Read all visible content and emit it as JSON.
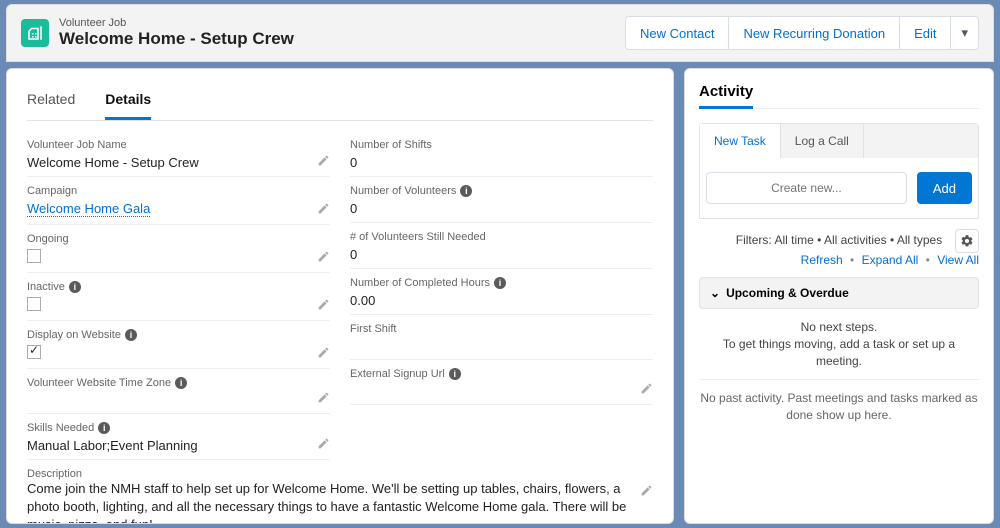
{
  "header": {
    "record_type": "Volunteer Job",
    "record_name": "Welcome Home - Setup Crew",
    "actions": {
      "new_contact": "New Contact",
      "new_recurring_donation": "New Recurring Donation",
      "edit": "Edit"
    }
  },
  "main_tabs": {
    "related": "Related",
    "details": "Details"
  },
  "fields": {
    "left": [
      {
        "label": "Volunteer Job Name",
        "value": "Welcome Home - Setup Crew",
        "info": false,
        "edit": true,
        "type": "text"
      },
      {
        "label": "Campaign",
        "value": "Welcome Home Gala",
        "info": false,
        "edit": true,
        "type": "link"
      },
      {
        "label": "Ongoing",
        "value": "",
        "info": false,
        "edit": true,
        "type": "checkbox",
        "checked": false
      },
      {
        "label": "Inactive",
        "value": "",
        "info": true,
        "edit": true,
        "type": "checkbox",
        "checked": false
      },
      {
        "label": "Display on Website",
        "value": "",
        "info": true,
        "edit": true,
        "type": "checkbox",
        "checked": true
      },
      {
        "label": "Volunteer Website Time Zone",
        "value": "",
        "info": true,
        "edit": true,
        "type": "text"
      },
      {
        "label": "Skills Needed",
        "value": "Manual Labor;Event Planning",
        "info": true,
        "edit": true,
        "type": "text"
      }
    ],
    "right": [
      {
        "label": "Number of Shifts",
        "value": "0",
        "info": false,
        "edit": false,
        "type": "text"
      },
      {
        "label": "Number of Volunteers",
        "value": "0",
        "info": true,
        "edit": false,
        "type": "text"
      },
      {
        "label": "# of Volunteers Still Needed",
        "value": "0",
        "info": false,
        "edit": false,
        "type": "text"
      },
      {
        "label": "Number of Completed Hours",
        "value": "0.00",
        "info": true,
        "edit": false,
        "type": "text"
      },
      {
        "label": "First Shift",
        "value": "",
        "info": false,
        "edit": false,
        "type": "text"
      },
      {
        "label": "External Signup Url",
        "value": "",
        "info": true,
        "edit": true,
        "type": "text"
      }
    ],
    "description": {
      "label": "Description",
      "value": "Come join the NMH staff to help set up for Welcome Home. We'll be setting up tables, chairs, flowers, a photo booth, lighting, and all the necessary things to have a fantastic Welcome Home gala. There will be music, pizza, and fun!"
    }
  },
  "activity": {
    "title": "Activity",
    "tabs": {
      "new_task": "New Task",
      "log_call": "Log a Call"
    },
    "create_placeholder": "Create new...",
    "add": "Add",
    "filters_text": "Filters: All time  •  All activities  •  All types",
    "links": {
      "refresh": "Refresh",
      "expand": "Expand All",
      "view_all": "View All"
    },
    "upcoming_label": "Upcoming & Overdue",
    "no_next_title": "No next steps.",
    "no_next_sub": "To get things moving, add a task or set up a meeting.",
    "no_past": "No past activity. Past meetings and tasks marked as done show up here."
  }
}
